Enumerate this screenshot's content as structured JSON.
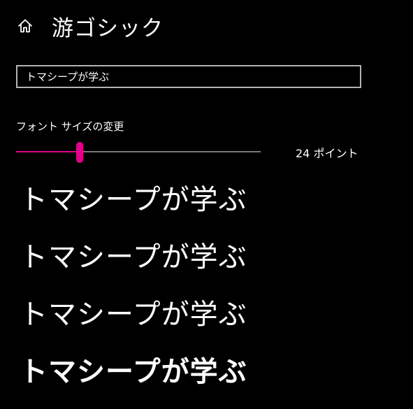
{
  "header": {
    "title": "游ゴシック",
    "home_icon": "home-icon"
  },
  "preview": {
    "value": "トマシープが学ぶ"
  },
  "font_size": {
    "label": "フォント サイズの変更",
    "value_text": "24 ポイント",
    "slider_fraction": 0.26,
    "accent_color": "#e3008c",
    "track_color": "#7a7a7a"
  },
  "samples": [
    {
      "text": "トマシープが学ぶ",
      "weight": "light"
    },
    {
      "text": "トマシープが学ぶ",
      "weight": "regular"
    },
    {
      "text": "トマシープが学ぶ",
      "weight": "medium"
    },
    {
      "text": "トマシープが学ぶ",
      "weight": "bold"
    }
  ]
}
